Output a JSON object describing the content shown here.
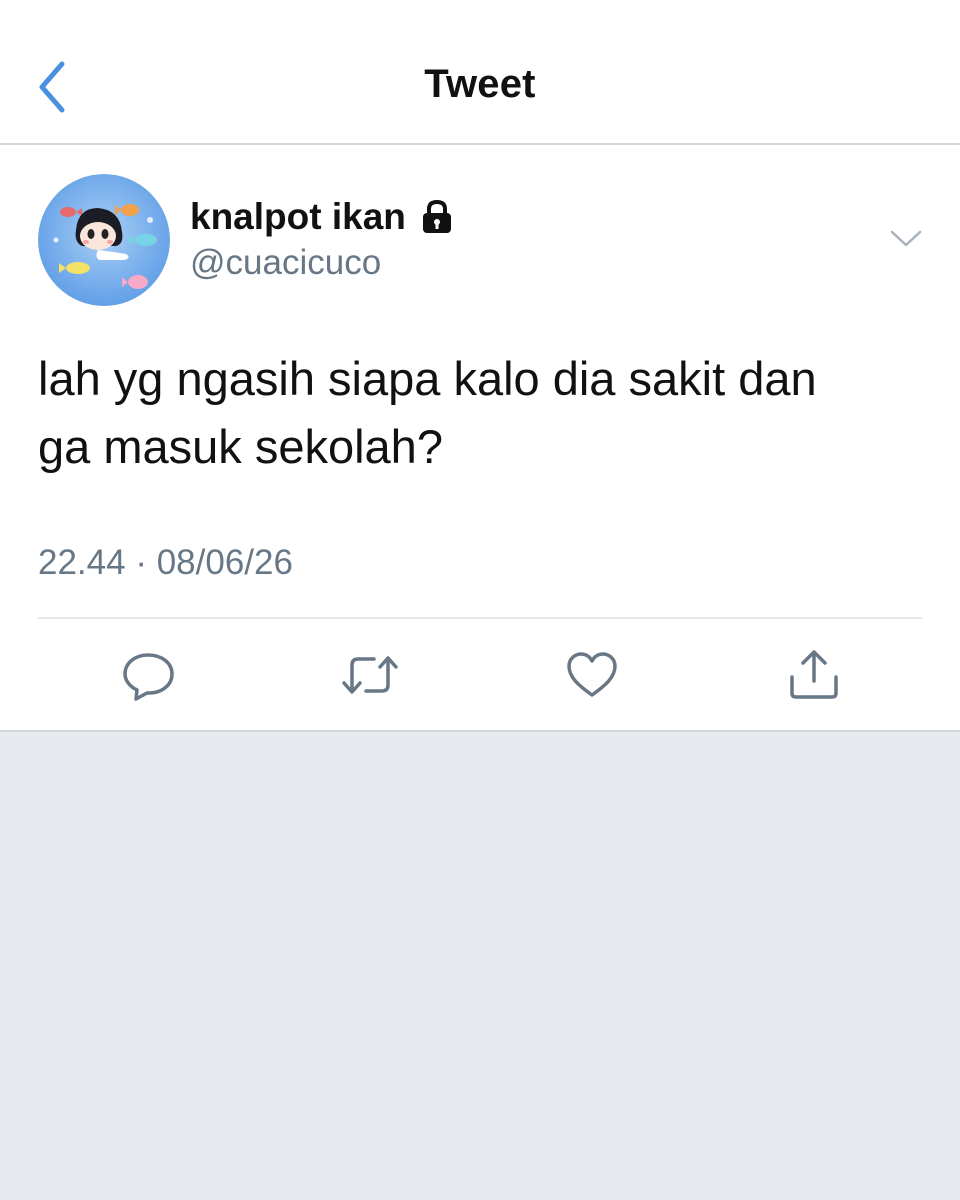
{
  "nav": {
    "title": "Tweet",
    "back_icon": "chevron-left-icon"
  },
  "tweet": {
    "author": {
      "display_name": "knalpot ikan",
      "handle": "@cuacicuco",
      "protected_icon": "lock-icon"
    },
    "text_lines": [
      "lah yg ngasih siapa kalo dia sakit dan",
      "ga masuk sekolah?"
    ],
    "time": "22.44",
    "separator": "·",
    "date": "08/06/26",
    "actions": [
      "reply-icon",
      "retweet-icon",
      "like-icon",
      "share-icon"
    ]
  },
  "colors": {
    "accent": "#1da1f2",
    "back_chevron": "#4a90e2",
    "text_primary": "#111111",
    "text_secondary": "#687785",
    "icon_gray": "#687785",
    "background": "#e6e9ee",
    "divider": "#d3d7dc"
  }
}
